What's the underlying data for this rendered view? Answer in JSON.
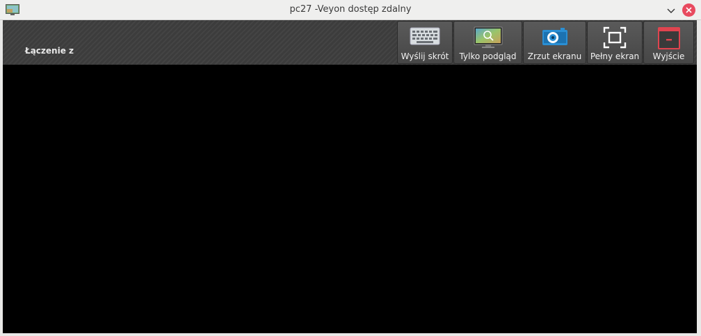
{
  "window": {
    "title": "pc27 -Veyon dostęp zdalny",
    "app_icon": "veyon-monitor-icon",
    "controls": [
      "chevron-down-icon",
      "close-icon"
    ],
    "close_color": "#e84a5f"
  },
  "toolbar": {
    "status_label": "Łączenie z",
    "buttons": [
      {
        "label": "Wyślij skrót",
        "icon": "keyboard-icon"
      },
      {
        "label": "Tylko podgląd",
        "icon": "view-only-monitor-icon"
      },
      {
        "label": "Zrzut ekranu",
        "icon": "camera-icon"
      },
      {
        "label": "Pełny ekran",
        "icon": "fullscreen-icon"
      },
      {
        "label": "Wyjście",
        "icon": "exit-window-icon"
      }
    ]
  },
  "colors": {
    "toolbar_bg": "#3c3c3c",
    "screen_bg": "#000000",
    "exit_accent": "#e0444f",
    "camera_accent": "#2a8fd4"
  }
}
